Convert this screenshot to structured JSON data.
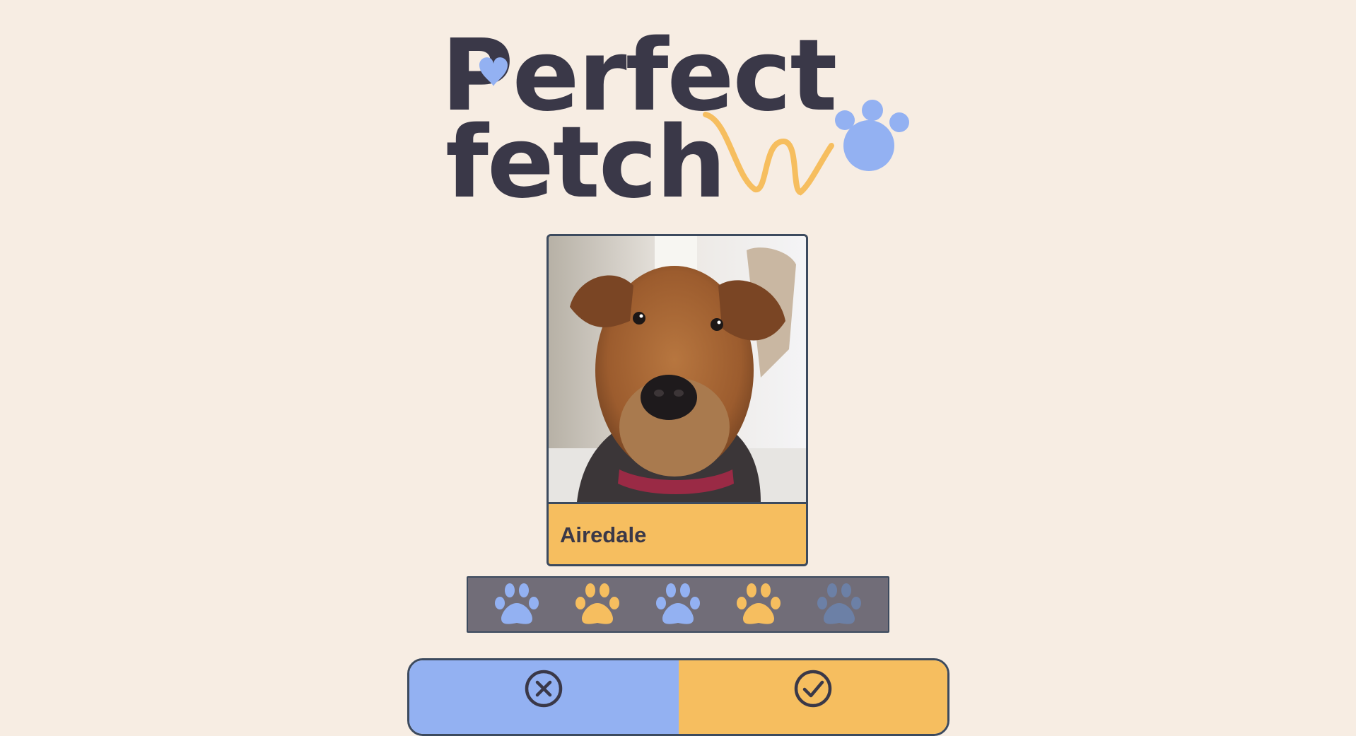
{
  "app": {
    "logo_text": "Perfect fetch",
    "logo_line1": "Perfect",
    "logo_line2": "fetch"
  },
  "card": {
    "breed": "Airedale",
    "photo_alt": "Airedale"
  },
  "rating": {
    "max": 5,
    "paws": [
      {
        "name": "paw-rating-1",
        "color": "#93b1f2"
      },
      {
        "name": "paw-rating-2",
        "color": "#f6be5f"
      },
      {
        "name": "paw-rating-3",
        "color": "#93b1f2"
      },
      {
        "name": "paw-rating-4",
        "color": "#f6be5f"
      },
      {
        "name": "paw-rating-5",
        "color": "#6c80a6"
      }
    ]
  },
  "actions": {
    "reject_icon": "x-circle-icon",
    "accept_icon": "check-circle-icon"
  },
  "colors": {
    "background": "#f7ede3",
    "ink": "#3a3848",
    "blue": "#93b1f2",
    "orange": "#f6be5f",
    "border": "#3c4a5e",
    "rating_bg": "#716d78"
  }
}
